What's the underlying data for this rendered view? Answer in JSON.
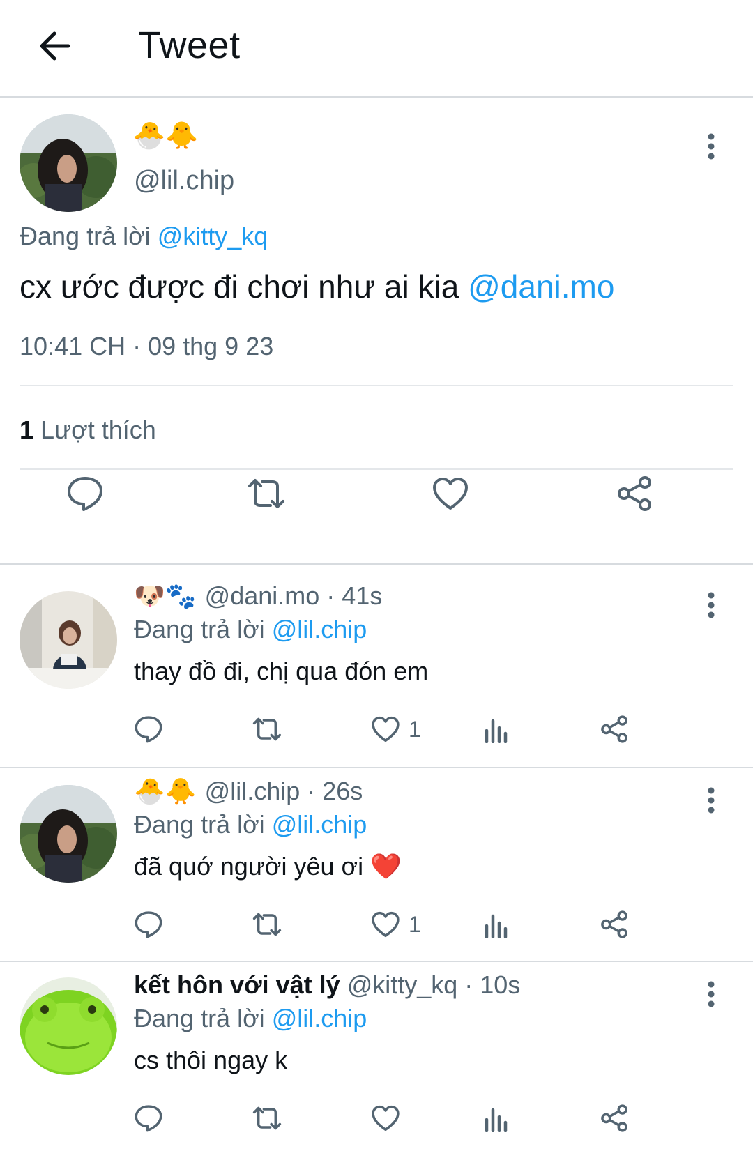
{
  "header": {
    "title": "Tweet"
  },
  "main_tweet": {
    "display_name": "🐣🐥",
    "handle": "@lil.chip",
    "reply_prefix": "Đang trả lời",
    "reply_to": "@kitty_kq",
    "text": "cx ước được đi chơi như ai kia",
    "mention": "@dani.mo",
    "timestamp": "10:41 CH · 09 thg 9 23",
    "likes_count": "1",
    "likes_label": "Lượt thích"
  },
  "replies": [
    {
      "display_name": "🐶🐾",
      "handle": "@dani.mo",
      "time": "· 41s",
      "reply_prefix": "Đang trả lời",
      "reply_to": "@lil.chip",
      "text": "thay đồ đi, chị qua đón em",
      "like_count": "1"
    },
    {
      "display_name": "🐣🐥",
      "handle": "@lil.chip",
      "time": "· 26s",
      "reply_prefix": "Đang trả lời",
      "reply_to": "@lil.chip",
      "text": "đã quớ người yêu ơi",
      "text_emoji": "❤️",
      "like_count": "1"
    },
    {
      "display_name": "kết hôn với vật lý",
      "handle": "@kitty_kq",
      "time": "· 10s",
      "reply_prefix": "Đang trả lời",
      "reply_to": "@lil.chip",
      "text": "cs thôi ngay k",
      "like_count": ""
    }
  ],
  "icons": {
    "back": "arrow-left-icon",
    "more": "more-vertical-icon",
    "reply": "reply-icon",
    "retweet": "retweet-icon",
    "like": "heart-icon",
    "views": "views-icon",
    "share": "share-icon"
  },
  "colors": {
    "link": "#1d9bf0",
    "secondary_text": "#536471",
    "primary_text": "#0f1419"
  }
}
